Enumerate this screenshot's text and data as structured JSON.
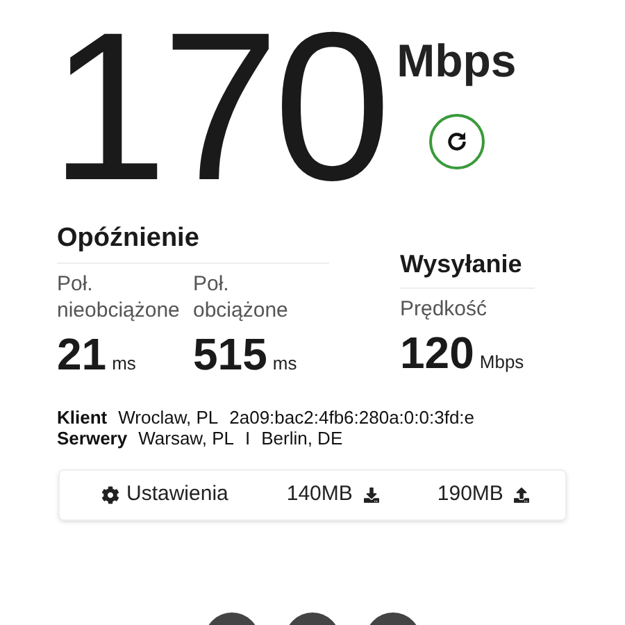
{
  "speed": {
    "value": "170",
    "unit": "Mbps"
  },
  "latency": {
    "title": "Opóźnienie",
    "items": [
      {
        "label": "Poł. nieobciążone",
        "value": "21",
        "unit": "ms"
      },
      {
        "label": "Poł. obciążone",
        "value": "515",
        "unit": "ms"
      }
    ]
  },
  "upload": {
    "title": "Wysyłanie",
    "label": "Prędkość",
    "value": "120",
    "unit": "Mbps"
  },
  "info": [
    {
      "label": "Klient",
      "parts": [
        "Wroclaw, PL",
        "2a09:bac2:4fb6:280a:0:0:3fd:e"
      ]
    },
    {
      "label": "Serwery",
      "parts": [
        "Warsaw, PL",
        "I",
        "Berlin, DE"
      ]
    }
  ],
  "toolbar": {
    "settings": "Ustawienia",
    "items": [
      {
        "kind": "download",
        "text": "140MB"
      },
      {
        "kind": "upload",
        "text": "190MB"
      }
    ]
  },
  "bottom_buttons": [
    {
      "kind": "round"
    },
    {
      "kind": "round"
    },
    {
      "kind": "round"
    }
  ]
}
